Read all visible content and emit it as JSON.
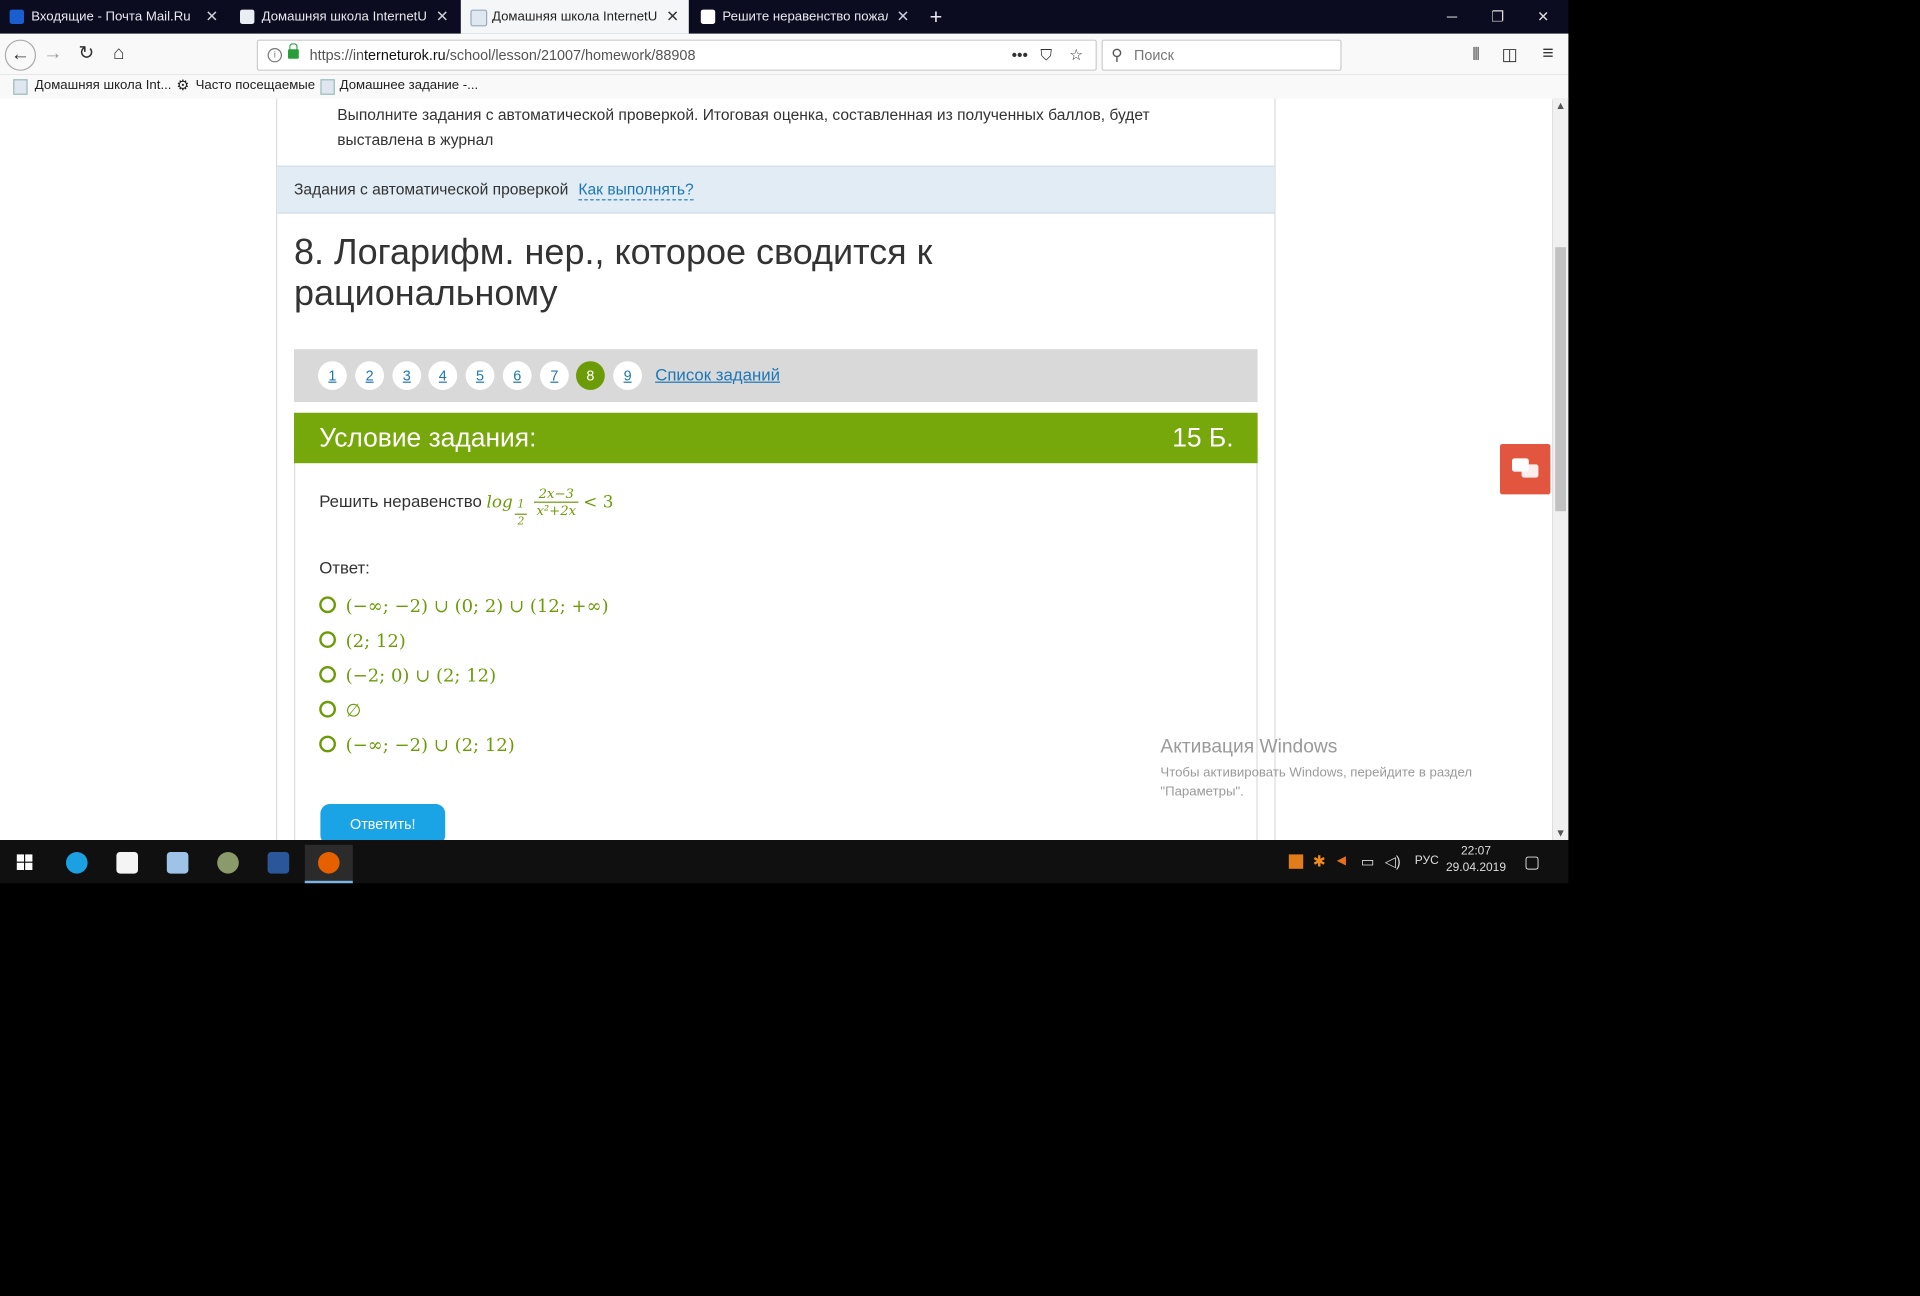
{
  "browser": {
    "tabs": [
      {
        "label": "Входящие - Почта Mail.Ru",
        "active": false
      },
      {
        "label": "Домашняя школа InternetUrok",
        "active": false
      },
      {
        "label": "Домашняя школа InternetUrok",
        "active": true
      },
      {
        "label": "Решите неравенство пожалуйс",
        "active": false
      }
    ],
    "url_prefix": "https://in",
    "url_host": "terneturok.ru",
    "url_path": "/school/lesson/21007/homework/88908",
    "search_placeholder": "Поиск",
    "bookmarks": [
      "Домашняя школа Int...",
      "Часто посещаемые",
      "Домашнее задание -..."
    ]
  },
  "page": {
    "intro_text": "Выполните задания с автоматической проверкой. Итоговая оценка, составленная из полученных баллов, будет выставлена в журнал",
    "auto_label": "Задания с автоматической проверкой",
    "how_link": "Как выполнять?",
    "title": "8. Логарифм. нер., которое сводится к рациональному",
    "pager": [
      "1",
      "2",
      "3",
      "4",
      "5",
      "6",
      "7",
      "8",
      "9"
    ],
    "pager_current": "8",
    "task_list_link": "Список заданий",
    "condition_header": "Условие задания:",
    "points": "15 Б.",
    "question_text": "Решить неравенство",
    "question_math": {
      "log": "log",
      "base_num": "1",
      "base_den": "2",
      "num": "2x−3",
      "den": "x²+2x",
      "rhs": "< 3"
    },
    "answer_label": "Ответ:",
    "options": [
      "(−∞; −2) ∪ (0; 2) ∪ (12; +∞)",
      "(2; 12)",
      "(−2; 0) ∪ (2; 12)",
      "∅",
      "(−∞; −2) ∪ (2; 12)"
    ],
    "submit_label": "Ответить!"
  },
  "watermark": {
    "title": "Активация Windows",
    "line1": "Чтобы активировать Windows, перейдите в раздел",
    "line2": "\"Параметры\"."
  },
  "taskbar": {
    "lang": "РУС",
    "time": "22:07",
    "date": "29.04.2019"
  },
  "colors": {
    "accent_green": "#76a70b",
    "link_blue": "#1d77b7",
    "submit_blue": "#1aa4e6",
    "chat_red": "#e2563f"
  }
}
